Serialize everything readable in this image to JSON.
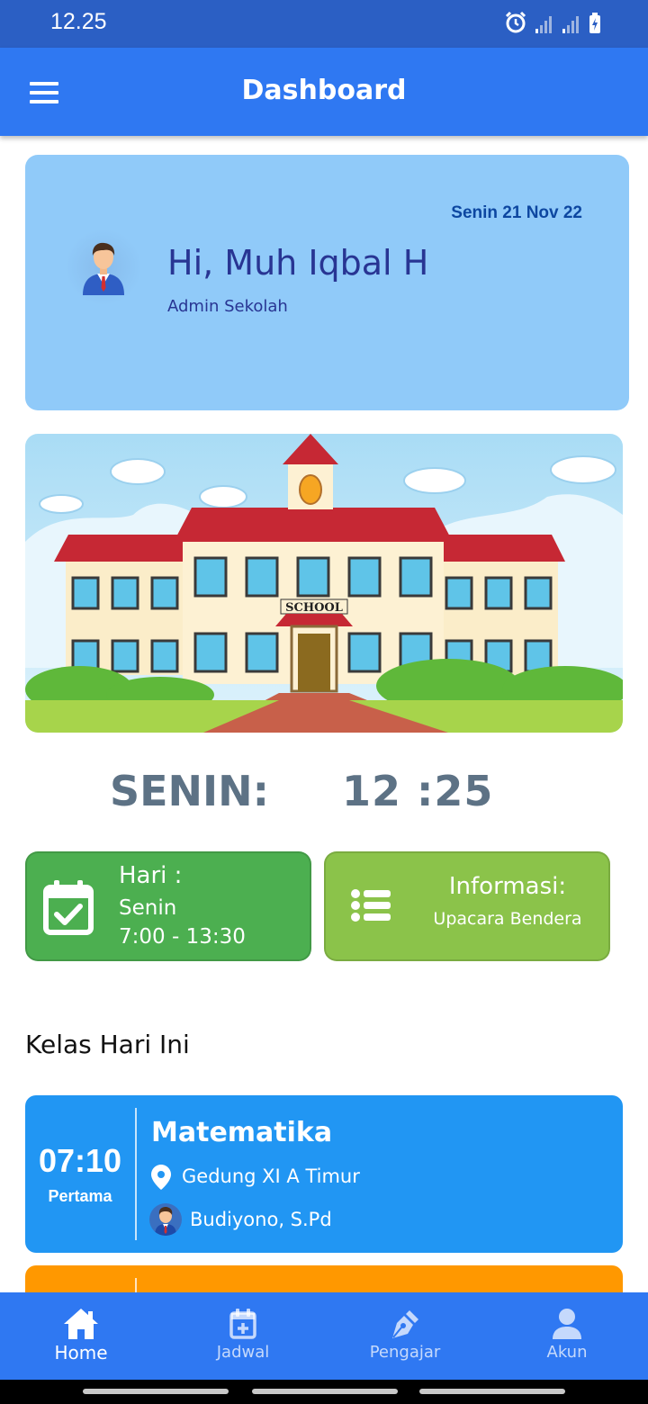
{
  "status_bar": {
    "time": "12.25"
  },
  "app_bar": {
    "title": "Dashboard"
  },
  "greeting": {
    "date": "Senin 21 Nov 22",
    "name": "Hi, Muh Iqbal H",
    "role": "Admin Sekolah"
  },
  "banner": {
    "sign_text": "SCHOOL"
  },
  "clock": {
    "day": "SENIN:",
    "time": "12 :25"
  },
  "day_card": {
    "title": "Hari :",
    "day": "Senin",
    "hours": "7:00 - 13:30"
  },
  "info_card": {
    "title": "Informasi:",
    "text": "Upacara Bendera"
  },
  "section": {
    "title": "Kelas Hari Ini"
  },
  "classes": [
    {
      "time": "07:10",
      "order": "Pertama",
      "subject": "Matematika",
      "location": "Gedung XI A Timur",
      "teacher": "Budiyono, S.Pd",
      "color": "#2196f3"
    },
    {
      "color": "#ff9800"
    }
  ],
  "bottom_nav": [
    {
      "label": "Home",
      "icon": "home-icon",
      "active": true
    },
    {
      "label": "Jadwal",
      "icon": "calendar-add-icon",
      "active": false
    },
    {
      "label": "Pengajar",
      "icon": "pen-nib-icon",
      "active": false
    },
    {
      "label": "Akun",
      "icon": "person-icon",
      "active": false
    }
  ],
  "colors": {
    "status_bar": "#2b5fc4",
    "app_bar": "#2f78f2",
    "greeting_card": "#90caf9",
    "day_card": "#4caf50",
    "info_card": "#8bc34a"
  }
}
